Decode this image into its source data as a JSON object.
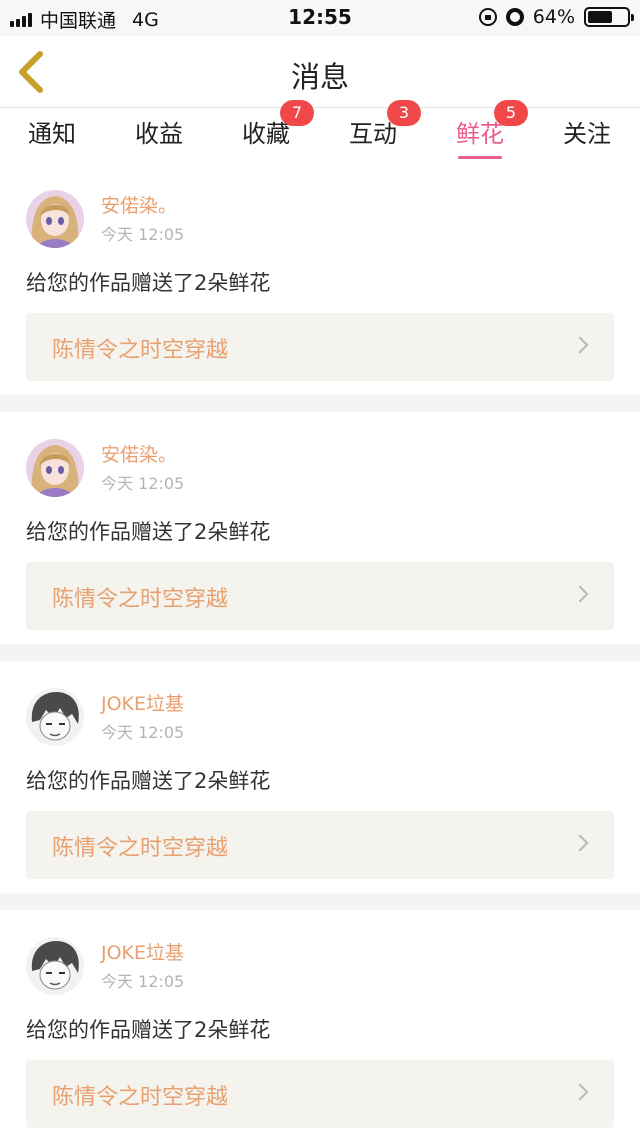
{
  "status_bar": {
    "carrier": "中国联通",
    "network": "4G",
    "time": "12:55",
    "battery_text": "64%",
    "battery_level": 0.64
  },
  "header": {
    "title": "消息",
    "back_icon": "chevron-left-icon"
  },
  "tabs": [
    {
      "label": "通知",
      "badge": ""
    },
    {
      "label": "收益",
      "badge": ""
    },
    {
      "label": "收藏",
      "badge": "7"
    },
    {
      "label": "互动",
      "badge": "3"
    },
    {
      "label": "鲜花",
      "badge": "5",
      "active": true
    },
    {
      "label": "关注",
      "badge": ""
    }
  ],
  "colors": {
    "accent_pink": "#e85c92",
    "username_orange": "#e8a070",
    "badge_red": "#f04848"
  },
  "feed": [
    {
      "user": "安偌染。",
      "time": "今天 12:05",
      "message": "给您的作品赠送了2朵鲜花",
      "work_title": "陈情令之时空穿越",
      "avatar": "anime-girl-avatar"
    },
    {
      "user": "安偌染。",
      "time": "今天 12:05",
      "message": "给您的作品赠送了2朵鲜花",
      "work_title": "陈情令之时空穿越",
      "avatar": "anime-girl-avatar"
    },
    {
      "user": "JOKE垃基",
      "time": "今天 12:05",
      "message": "给您的作品赠送了2朵鲜花",
      "work_title": "陈情令之时空穿越",
      "avatar": "sketch-boy-avatar"
    },
    {
      "user": "JOKE垃基",
      "time": "今天 12:05",
      "message": "给您的作品赠送了2朵鲜花",
      "work_title": "陈情令之时空穿越",
      "avatar": "sketch-boy-avatar"
    }
  ]
}
